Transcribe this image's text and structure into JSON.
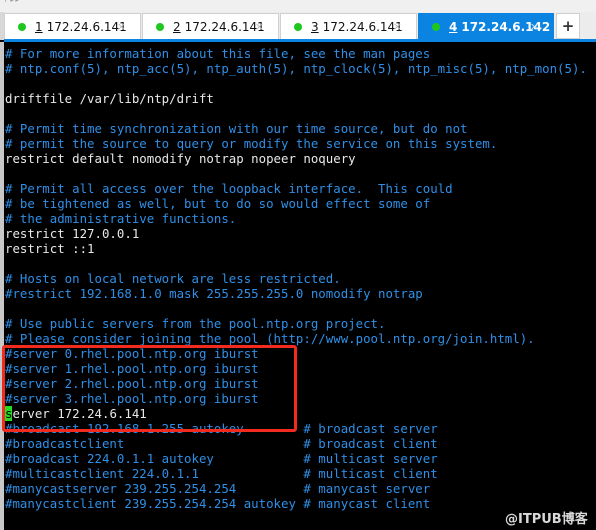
{
  "tabs": [
    {
      "num": "1",
      "label": "172.24.6.141",
      "status_color": "#1ec71e",
      "active": false,
      "close": "×"
    },
    {
      "num": "2",
      "label": "172.24.6.141",
      "status_color": "#1ec71e",
      "active": false,
      "close": "×"
    },
    {
      "num": "3",
      "label": "172.24.6.141",
      "status_color": "#1ec71e",
      "active": false,
      "close": "×"
    },
    {
      "num": "4",
      "label": "172.24.6.142",
      "status_color": "#1ec71e",
      "active": true,
      "close": "×"
    }
  ],
  "new_tab_label": "+",
  "terminal": {
    "lines": [
      {
        "text": "# For more information about this file, see the man pages",
        "kind": "comment"
      },
      {
        "text": "# ntp.conf(5), ntp_acc(5), ntp_auth(5), ntp_clock(5), ntp_misc(5), ntp_mon(5).",
        "kind": "comment"
      },
      {
        "text": "",
        "kind": "blank"
      },
      {
        "text": "driftfile /var/lib/ntp/drift",
        "kind": "plain"
      },
      {
        "text": "",
        "kind": "blank"
      },
      {
        "text": "# Permit time synchronization with our time source, but do not",
        "kind": "comment"
      },
      {
        "text": "# permit the source to query or modify the service on this system.",
        "kind": "comment"
      },
      {
        "text": "restrict default nomodify notrap nopeer noquery",
        "kind": "plain"
      },
      {
        "text": "",
        "kind": "blank"
      },
      {
        "text": "# Permit all access over the loopback interface.  This could",
        "kind": "comment"
      },
      {
        "text": "# be tightened as well, but to do so would effect some of",
        "kind": "comment"
      },
      {
        "text": "# the administrative functions.",
        "kind": "comment"
      },
      {
        "text": "restrict 127.0.0.1",
        "kind": "plain"
      },
      {
        "text": "restrict ::1",
        "kind": "plain"
      },
      {
        "text": "",
        "kind": "blank"
      },
      {
        "text": "# Hosts on local network are less restricted.",
        "kind": "comment"
      },
      {
        "text": "#restrict 192.168.1.0 mask 255.255.255.0 nomodify notrap",
        "kind": "comment"
      },
      {
        "text": "",
        "kind": "blank"
      },
      {
        "text": "# Use public servers from the pool.ntp.org project.",
        "kind": "comment"
      },
      {
        "text": "# Please consider joining the pool (http://www.pool.ntp.org/join.html).",
        "kind": "comment"
      },
      {
        "text": "#server 0.rhel.pool.ntp.org iburst",
        "kind": "comment"
      },
      {
        "text": "#server 1.rhel.pool.ntp.org iburst",
        "kind": "comment"
      },
      {
        "text": "#server 2.rhel.pool.ntp.org iburst",
        "kind": "comment"
      },
      {
        "text": "#server 3.rhel.pool.ntp.org iburst",
        "kind": "comment"
      },
      {
        "text": "server 172.24.6.141",
        "kind": "cursor",
        "cursor_char": "s",
        "rest": "erver 172.24.6.141"
      },
      {
        "text": "#broadcast 192.168.1.255 autokey        # broadcast server",
        "kind": "comment"
      },
      {
        "text": "#broadcastclient                        # broadcast client",
        "kind": "comment"
      },
      {
        "text": "#broadcast 224.0.1.1 autokey            # multicast server",
        "kind": "comment"
      },
      {
        "text": "#multicastclient 224.0.1.1              # multicast client",
        "kind": "comment"
      },
      {
        "text": "#manycastserver 239.255.254.254         # manycast server",
        "kind": "comment"
      },
      {
        "text": "#manycastclient 239.255.254.254 autokey # manycast client",
        "kind": "comment"
      }
    ],
    "comment_color": "#2f8fe6",
    "text_color": "#e8e8e8",
    "cursor_color": "#22dd22"
  },
  "annotation": {
    "color": "#f32a1e",
    "highlights": "server lines"
  },
  "watermark": "@ITPUB博客"
}
